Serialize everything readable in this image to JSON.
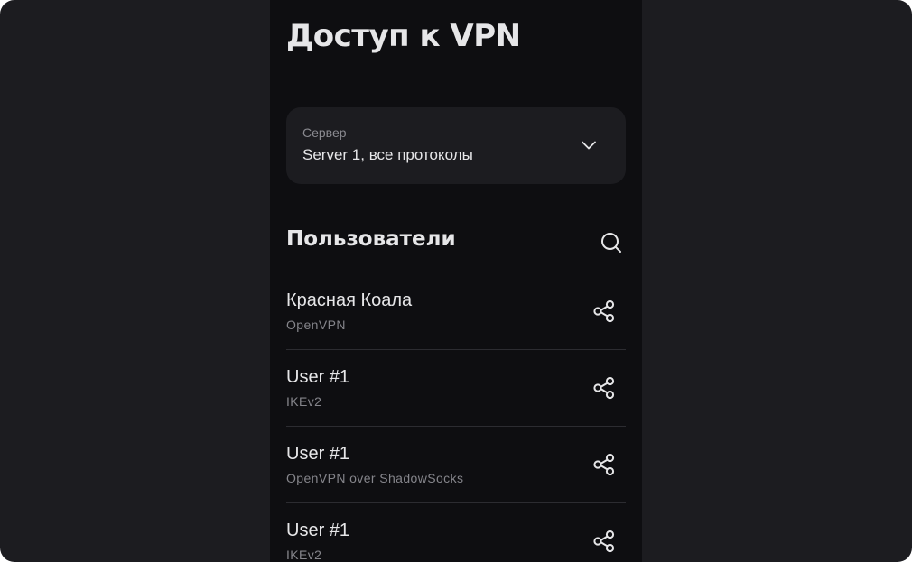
{
  "page": {
    "title": "Доступ к VPN"
  },
  "server": {
    "label": "Сервер",
    "value": "Server 1, все протоколы",
    "icon": "chevron-down-icon"
  },
  "users_section": {
    "title": "Пользователи",
    "search_icon": "search-icon"
  },
  "users": [
    {
      "name": "Красная Коала",
      "protocol": "OpenVPN"
    },
    {
      "name": "User #1",
      "protocol": "IKEv2"
    },
    {
      "name": "User #1",
      "protocol": "OpenVPN over ShadowSocks"
    },
    {
      "name": "User #1",
      "protocol": "IKEv2"
    }
  ],
  "colors": {
    "outer_background": "#1c1c20",
    "screen_background": "#0e0e11",
    "card_background": "#1c1c20",
    "primary_text": "#e6e6e8",
    "secondary_text": "#85858b",
    "divider": "#2c2c31"
  }
}
